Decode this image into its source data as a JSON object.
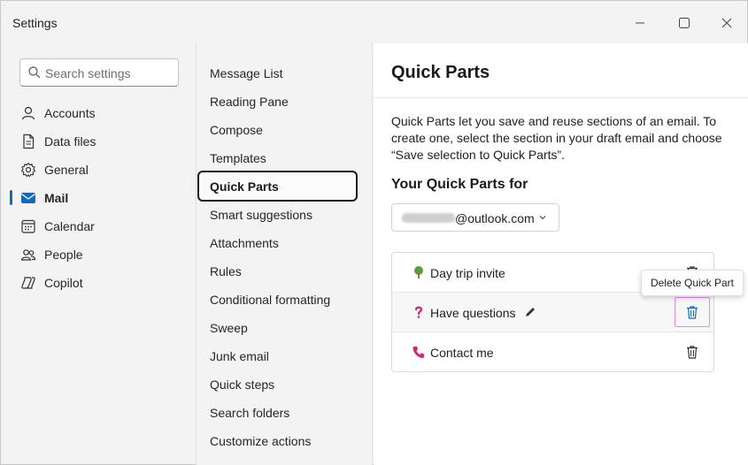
{
  "window": {
    "title": "Settings"
  },
  "search": {
    "placeholder": "Search settings"
  },
  "nav": [
    {
      "label": "Accounts",
      "icon": "person-icon"
    },
    {
      "label": "Data files",
      "icon": "document-icon"
    },
    {
      "label": "General",
      "icon": "gear-icon"
    },
    {
      "label": "Mail",
      "icon": "mail-icon",
      "active": true
    },
    {
      "label": "Calendar",
      "icon": "calendar-icon"
    },
    {
      "label": "People",
      "icon": "people-icon"
    },
    {
      "label": "Copilot",
      "icon": "copilot-icon"
    }
  ],
  "mail_nav": [
    "Message List",
    "Reading Pane",
    "Compose",
    "Templates",
    "Quick Parts",
    "Smart suggestions",
    "Attachments",
    "Rules",
    "Conditional formatting",
    "Sweep",
    "Junk email",
    "Quick steps",
    "Search folders",
    "Customize actions"
  ],
  "mail_nav_selected": "Quick Parts",
  "pane": {
    "title": "Quick Parts",
    "description": "Quick Parts let you save and reuse sections of an email. To create one, select the section in your draft email and choose “Save selection to Quick Parts”.",
    "subheading": "Your Quick Parts for",
    "account_suffix": "@outlook.com"
  },
  "quick_parts": [
    {
      "label": "Day trip invite",
      "icon": "tree-icon",
      "emoji": "🌳"
    },
    {
      "label": "Have questions",
      "icon": "question-mark-icon",
      "emoji": "❓",
      "hovered": true
    },
    {
      "label": "Contact me",
      "icon": "phone-icon",
      "emoji": "📞"
    }
  ],
  "tooltip": "Delete Quick Part",
  "colors": {
    "accent": "#0f6cbd",
    "focus": "#e48ce8"
  }
}
